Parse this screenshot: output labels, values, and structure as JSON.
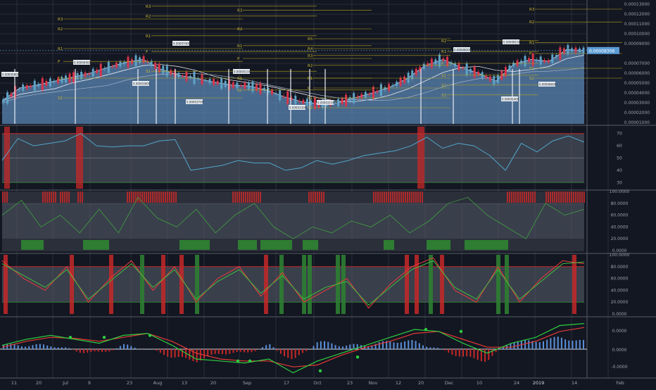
{
  "colors": {
    "background": "#131722",
    "grid": "#2a2e39",
    "separator": "#555b66",
    "area_fill": "#5b86b3",
    "up_candle": "#5ea3c7",
    "down_candle": "#d8354b",
    "pivot_line": "#b5a41f",
    "pivot_label": "#c9b72a",
    "rsi_line": "#4fa6c9",
    "osc_fast": "#ef3b3b",
    "osc_slow": "#3fbf3f",
    "macd_line": "#2ecc40",
    "signal_line": "#e53935",
    "red_band": "#c62828",
    "green_band": "#2e7d32",
    "axis_text": "#9aa1ad",
    "price_tag": "#5b9bd5"
  },
  "price_axis": {
    "ticks": [
      "0.00013000",
      "0.00012000",
      "0.00011000",
      "0.00010000",
      "0.00009000",
      "0.00007000",
      "0.00006000",
      "0.00005000",
      "0.00004000",
      "0.00003000",
      "0.00002000",
      "0.00001000"
    ],
    "current_price_tag": "0.00008306"
  },
  "rsi_axis": {
    "ticks": [
      "70",
      "60",
      "50",
      "40",
      "30"
    ]
  },
  "osc1_axis": {
    "ticks": [
      "100.0000",
      "80.0000",
      "60.0000",
      "40.0000",
      "20.0000",
      "0.0000"
    ]
  },
  "osc2_axis": {
    "ticks": [
      "100.0000",
      "80.0000",
      "60.0000",
      "40.0000",
      "20.0000",
      "0.0000"
    ]
  },
  "macd_axis": {
    "ticks": [
      "0.0000",
      "0.0000",
      "-0.0000"
    ]
  },
  "time_axis": {
    "labels": [
      "11",
      "20",
      "Jul",
      "9",
      "23",
      "Aug",
      "13",
      "20",
      "Sep",
      "17",
      "Oct",
      "23",
      "Nov",
      "12",
      "20",
      "Dec",
      "10",
      "24",
      "2019",
      "14",
      "Feb"
    ]
  },
  "pivot_labels": {
    "r3": "R3",
    "r2": "R2",
    "r1": "R1",
    "p": "P",
    "s1": "S1",
    "s2": "S2",
    "r4": "R4",
    "r5": "R5",
    "r6": "R6"
  },
  "chart_data": [
    {
      "type": "line",
      "panel": "price",
      "price_scale": "0.00001000 – 0.00013000",
      "series": [
        {
          "name": "",
          "values": [
            3.2e-05,
            4.5e-05,
            4.8e-05,
            5.2e-05,
            5.6e-05,
            6e-05,
            6.6e-05,
            7.1e-05,
            7.4e-05,
            6.4e-05,
            5.8e-05,
            5.5e-05,
            5.1e-05,
            4.8e-05,
            4.7e-05,
            4.3e-05,
            3.6e-05,
            3.1e-05,
            2.9e-05,
            3e-05,
            3.5e-05,
            4e-05,
            4.6e-05,
            5.5e-05,
            6.8e-05,
            7.4e-05,
            6.6e-05,
            6e-05,
            5.2e-05,
            6.9e-05,
            7.4e-05,
            7.2e-05,
            8.4e-05,
            8.3e-05
          ]
        }
      ]
    },
    {
      "type": "line",
      "panel": "rsi",
      "ylim": [
        30,
        70
      ],
      "series": [
        {
          "name": "",
          "values": [
            48,
            66,
            60,
            62,
            64,
            70,
            60,
            59,
            60,
            60,
            64,
            65,
            40,
            42,
            44,
            48,
            46,
            46,
            40,
            42,
            48,
            45,
            48,
            52,
            54,
            56,
            60,
            67,
            58,
            62,
            60,
            52,
            40,
            62,
            55,
            64,
            68,
            63
          ]
        }
      ]
    },
    {
      "type": "line",
      "panel": "oscillator_1",
      "ylim": [
        0,
        100
      ],
      "series": [
        {
          "name": "",
          "values": [
            60,
            85,
            40,
            60,
            30,
            70,
            30,
            90,
            55,
            40,
            70,
            30,
            60,
            80,
            40,
            20,
            40,
            30,
            50,
            40,
            60,
            30,
            50,
            80,
            90,
            60,
            40,
            20,
            80,
            60,
            70
          ]
        }
      ]
    },
    {
      "type": "line",
      "panel": "oscillator_2",
      "ylim": [
        0,
        100
      ],
      "series": [
        {
          "name": "",
          "values": [
            90,
            60,
            40,
            80,
            20,
            60,
            90,
            40,
            80,
            20,
            60,
            80,
            30,
            70,
            20,
            40,
            60,
            10,
            50,
            80,
            95,
            40,
            20,
            80,
            20,
            60,
            90,
            85
          ]
        },
        {
          "name": "",
          "values": [
            85,
            65,
            45,
            75,
            25,
            55,
            85,
            45,
            75,
            25,
            55,
            75,
            35,
            65,
            25,
            45,
            55,
            15,
            45,
            75,
            90,
            45,
            25,
            75,
            25,
            55,
            85,
            88
          ]
        }
      ]
    },
    {
      "type": "line",
      "panel": "macd",
      "series": [
        {
          "name": "",
          "values": [
            0.2,
            0.5,
            0.7,
            0.5,
            0.3,
            0.7,
            0.8,
            0.2,
            -0.5,
            -0.6,
            -0.7,
            -0.5,
            -1.2,
            -0.6,
            -0.2,
            0.2,
            0.6,
            1.0,
            0.9,
            0.3,
            -0.2,
            0.3,
            0.6,
            1.2,
            1.3
          ]
        },
        {
          "name": "",
          "values": [
            0.1,
            0.4,
            0.6,
            0.55,
            0.4,
            0.6,
            0.8,
            0.4,
            -0.2,
            -0.5,
            -0.6,
            -0.6,
            -0.9,
            -0.8,
            -0.3,
            0.1,
            0.4,
            0.8,
            0.9,
            0.5,
            0.1,
            0.1,
            0.4,
            0.9,
            1.1
          ]
        }
      ]
    }
  ]
}
